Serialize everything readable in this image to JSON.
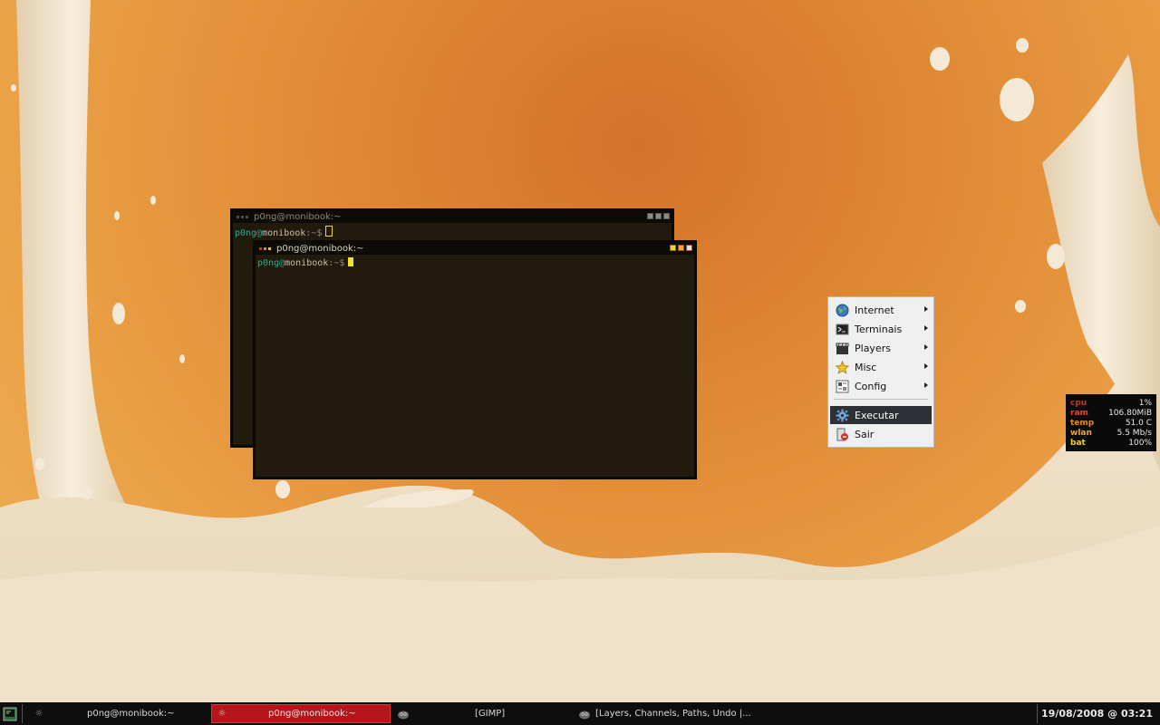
{
  "colors": {
    "accent_active_task": "#b5141a",
    "menu_selected": "#2d3136",
    "terminal_bg": "#221a0d",
    "prompt_user": "#2fa88c",
    "cursor": "#f2e030"
  },
  "terminals": [
    {
      "title": "p0ng@monibook:~",
      "prompt": {
        "user": "p0ng",
        "at": "@",
        "host": "monibook",
        "path": ":~",
        "sym": "$"
      },
      "focused": false
    },
    {
      "title": "p0ng@monibook:~",
      "prompt": {
        "user": "p0ng",
        "at": "@",
        "host": "monibook",
        "path": ":~",
        "sym": "$"
      },
      "focused": true
    }
  ],
  "menu": {
    "items": [
      {
        "label": "Internet",
        "icon": "globe-icon",
        "submenu": true
      },
      {
        "label": "Terminais",
        "icon": "terminal-icon",
        "submenu": true
      },
      {
        "label": "Players",
        "icon": "clapperboard-icon",
        "submenu": true
      },
      {
        "label": "Misc",
        "icon": "star-icon",
        "submenu": true
      },
      {
        "label": "Config",
        "icon": "config-icon",
        "submenu": true
      },
      {
        "label": "Executar",
        "icon": "gear-icon",
        "submenu": false,
        "selected": true
      },
      {
        "label": "Sair",
        "icon": "exit-icon",
        "submenu": false
      }
    ]
  },
  "conky": [
    {
      "key": "cpu",
      "value": "1%",
      "color": "#c0392b"
    },
    {
      "key": "ram",
      "value": "106.80MiB",
      "color": "#e04a2a"
    },
    {
      "key": "temp",
      "value": "51.0 C",
      "color": "#e8862b"
    },
    {
      "key": "wlan",
      "value": "5.5 Mb/s",
      "color": "#f0a82c"
    },
    {
      "key": "bat",
      "value": "100%",
      "color": "#f2d12c"
    }
  ],
  "taskbar": {
    "tasks": [
      {
        "label": "p0ng@monibook:~",
        "icon": "terminal-task-icon",
        "active": false
      },
      {
        "label": "p0ng@monibook:~",
        "icon": "terminal-task-icon",
        "active": true
      },
      {
        "label": "[GIMP]",
        "icon": "gimp-icon",
        "active": false
      },
      {
        "label": "[Layers, Channels, Paths, Undo |...",
        "icon": "gimp-icon",
        "active": false
      }
    ],
    "clock": "19/08/2008 @ 03:21"
  }
}
